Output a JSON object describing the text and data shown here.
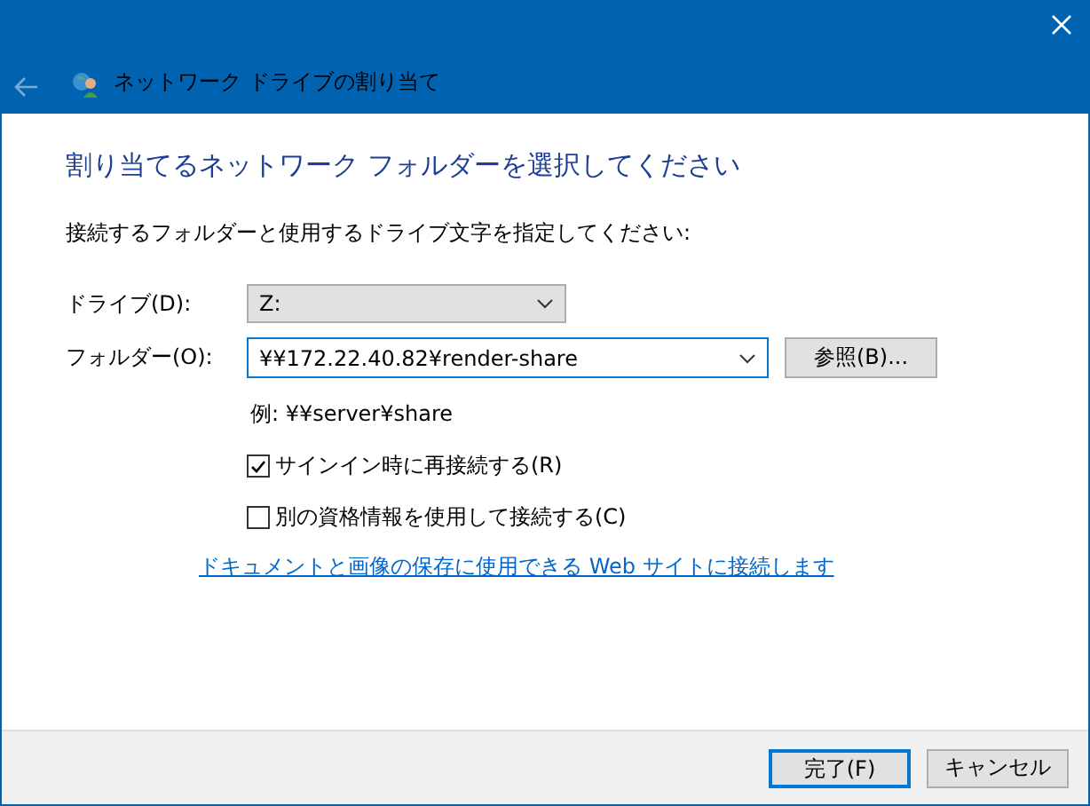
{
  "window": {
    "title": "ネットワーク ドライブの割り当て"
  },
  "heading": "割り当てるネットワーク フォルダーを選択してください",
  "instruction": "接続するフォルダーと使用するドライブ文字を指定してください:",
  "drive": {
    "label": "ドライブ(D):",
    "value": "Z:"
  },
  "folder": {
    "label": "フォルダー(O):",
    "value": "¥¥172.22.40.82¥render-share",
    "browse": "参照(B)..."
  },
  "example": "例: ¥¥server¥share",
  "options": [
    {
      "label": "サインイン時に再接続する(R)",
      "checked": true
    },
    {
      "label": "別の資格情報を使用して接続する(C)",
      "checked": false
    }
  ],
  "link": "ドキュメントと画像の保存に使用できる Web サイトに接続します",
  "buttons": [
    {
      "label": "完了(F)",
      "default": true
    },
    {
      "label": "キャンセル",
      "default": false
    }
  ]
}
